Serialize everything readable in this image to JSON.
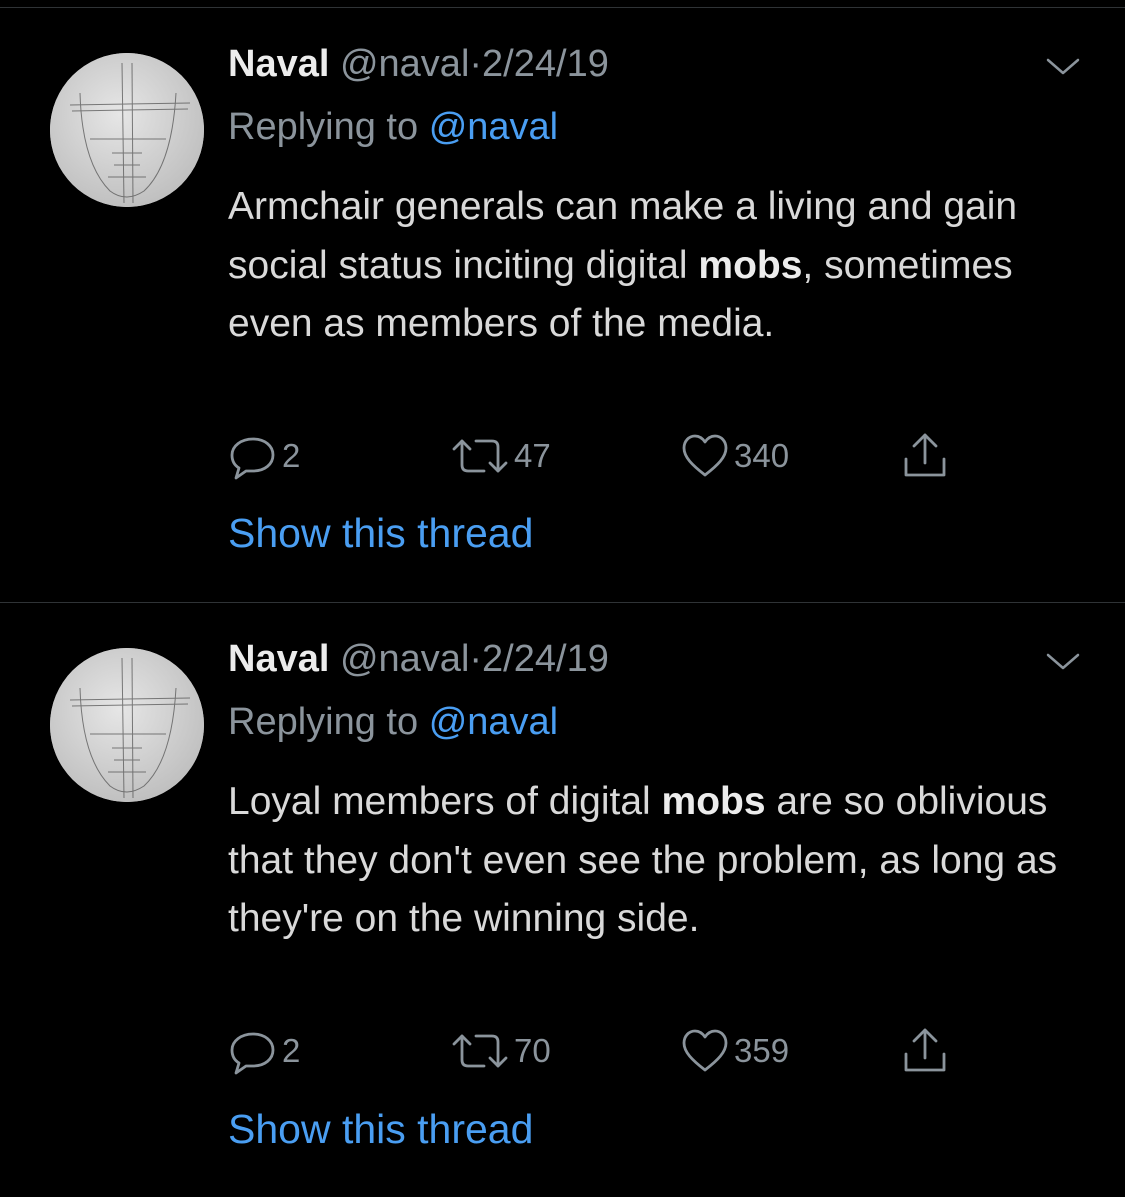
{
  "colors": {
    "background": "#000000",
    "text": "#d9d9d9",
    "secondary_text": "#8b949c",
    "link": "#4a9ef2",
    "divider": "#2f3336"
  },
  "tweets": [
    {
      "author_name": "Naval",
      "handle": "@naval",
      "separator": "·",
      "date": "2/24/19",
      "replying_prefix": "Replying to",
      "replying_to": "@naval",
      "text_before": "Armchair generals can make a living and gain social status inciting digital ",
      "text_bold": "mobs",
      "text_after": ", sometimes even as members of the media.",
      "reply_count": "2",
      "retweet_count": "47",
      "like_count": "340",
      "show_thread_label": "Show this thread",
      "icons": {
        "menu": "chevron-down-icon",
        "reply": "reply-icon",
        "retweet": "retweet-icon",
        "like": "heart-icon",
        "share": "share-icon"
      }
    },
    {
      "author_name": "Naval",
      "handle": "@naval",
      "separator": "·",
      "date": "2/24/19",
      "replying_prefix": "Replying to",
      "replying_to": "@naval",
      "text_before": "Loyal members of digital ",
      "text_bold": "mobs",
      "text_after": " are so oblivious that they don't even see the problem, as long as they're on the winning side.",
      "reply_count": "2",
      "retweet_count": "70",
      "like_count": "359",
      "show_thread_label": "Show this thread",
      "icons": {
        "menu": "chevron-down-icon",
        "reply": "reply-icon",
        "retweet": "retweet-icon",
        "like": "heart-icon",
        "share": "share-icon"
      }
    }
  ]
}
